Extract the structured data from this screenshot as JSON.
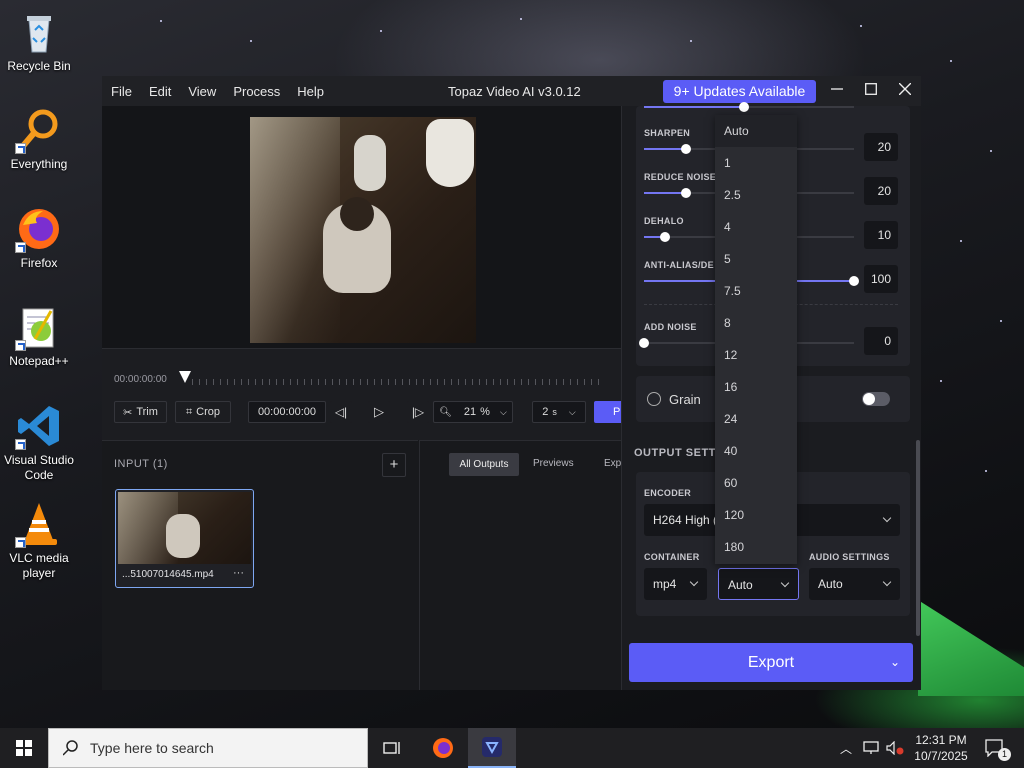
{
  "desktop": {
    "icons": [
      {
        "label": "Recycle Bin",
        "icon": "recycle-bin-icon"
      },
      {
        "label": "Everything",
        "icon": "everything-icon"
      },
      {
        "label": "Firefox",
        "icon": "firefox-icon"
      },
      {
        "label": "Notepad++",
        "icon": "notepad-plus-plus-icon"
      },
      {
        "label": "Visual Studio Code",
        "icon": "vscode-icon"
      },
      {
        "label": "VLC media player",
        "icon": "vlc-icon"
      }
    ]
  },
  "app": {
    "menu": [
      "File",
      "Edit",
      "View",
      "Process",
      "Help"
    ],
    "title": "Topaz Video AI  v3.0.12",
    "updates_label": "9+ Updates Available",
    "accent": "#5b5cf6"
  },
  "timeline": {
    "timecode_start": "00:00:00:00",
    "trim_label": "Trim",
    "crop_label": "Crop",
    "current_time": "00:00:00:00",
    "zoom_value": "21",
    "zoom_unit": "%",
    "speed_value": "2",
    "speed_unit": "s",
    "preview_label": "Previ"
  },
  "input_panel": {
    "title": "INPUT (1)",
    "add_label": "+",
    "file_name": "...51007014645.mp4",
    "more_label": "···"
  },
  "outputs_panel": {
    "tabs": [
      "All Outputs",
      "Previews",
      "Exports"
    ],
    "active_tab": "All Outputs"
  },
  "enhancement": {
    "sliders": [
      {
        "label": "SHARPEN",
        "value": "20",
        "fraction": 0.2
      },
      {
        "label": "REDUCE NOISE",
        "value": "20",
        "fraction": 0.2
      },
      {
        "label": "DEHALO",
        "value": "10",
        "fraction": 0.1
      },
      {
        "label": "ANTI-ALIAS/DE",
        "value": "100",
        "fraction": 1.0
      },
      {
        "label": "ADD NOISE",
        "value": "0",
        "fraction": 0.0
      }
    ],
    "grain_label": "Grain",
    "grain_enabled": false
  },
  "output_settings": {
    "section_title": "OUTPUT SETT",
    "encoder_label": "ENCODER",
    "encoder_value": "H264 High (",
    "container_label": "CONTAINER",
    "container_value": "mp4",
    "bitrate_value": "Auto",
    "audio_label": "AUDIO SETTINGS",
    "audio_value": "Auto"
  },
  "dropdown": {
    "options": [
      "Auto",
      "1",
      "2.5",
      "4",
      "5",
      "7.5",
      "8",
      "12",
      "16",
      "24",
      "40",
      "60",
      "120",
      "180"
    ],
    "selected": "Auto"
  },
  "export_label": "Export",
  "taskbar": {
    "search_placeholder": "Type here to search",
    "time": "12:31 PM",
    "date": "10/7/2025",
    "notification_count": "1"
  }
}
